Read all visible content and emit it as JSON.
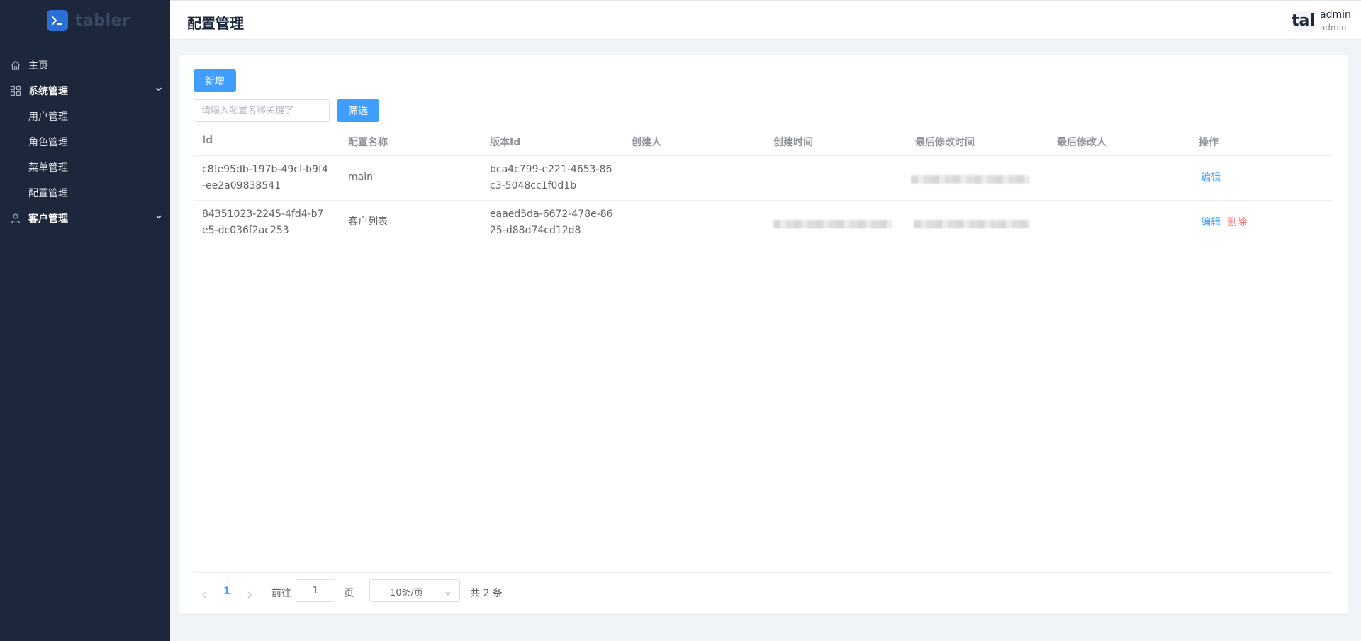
{
  "brand": {
    "name": "tabler",
    "accent": "#2a6fd6"
  },
  "sidebar": {
    "items": [
      {
        "label": "主页",
        "icon": "home-icon"
      },
      {
        "label": "系统管理",
        "icon": "grid-icon",
        "expanded": true
      },
      {
        "label": "用户管理"
      },
      {
        "label": "角色管理"
      },
      {
        "label": "菜单管理"
      },
      {
        "label": "配置管理",
        "active": true
      },
      {
        "label": "客户管理",
        "icon": "user-icon",
        "expanded": true
      }
    ]
  },
  "header": {
    "title": "配置管理",
    "avatar_text": "tabler",
    "user_name": "admin",
    "user_role": "admin"
  },
  "toolbar": {
    "add_label": "新增",
    "filter_label": "筛选",
    "search_placeholder": "请输入配置名称关键字"
  },
  "table": {
    "headers": [
      "Id",
      "配置名称",
      "版本Id",
      "创建人",
      "创建时间",
      "最后修改时间",
      "最后修改人",
      "操作"
    ],
    "rows": [
      {
        "id": "c8fe95db-197b-49cf-b9f4-ee2a09838541",
        "name": "main",
        "version_id": "bca4c799-e221-4653-86c3-5048cc1f0d1b",
        "creator": "",
        "edit": "编辑"
      },
      {
        "id": "84351023-2245-4fd4-b7e5-dc036f2ac253",
        "name": "客户列表",
        "version_id": "eaaed5da-6672-478e-8625-d88d74cd12d8",
        "creator": "",
        "edit": "编辑",
        "delete": "删除"
      }
    ]
  },
  "pagination": {
    "current_page": "1",
    "goto_prefix": "前往",
    "goto_value": "1",
    "goto_suffix": "页",
    "page_size": "10条/页",
    "total": "共 2 条"
  },
  "colors": {
    "sidebar_bg": "#1d273b",
    "primary": "#409eff",
    "danger": "#f56c6c",
    "page_bg": "#f0f3f8"
  }
}
